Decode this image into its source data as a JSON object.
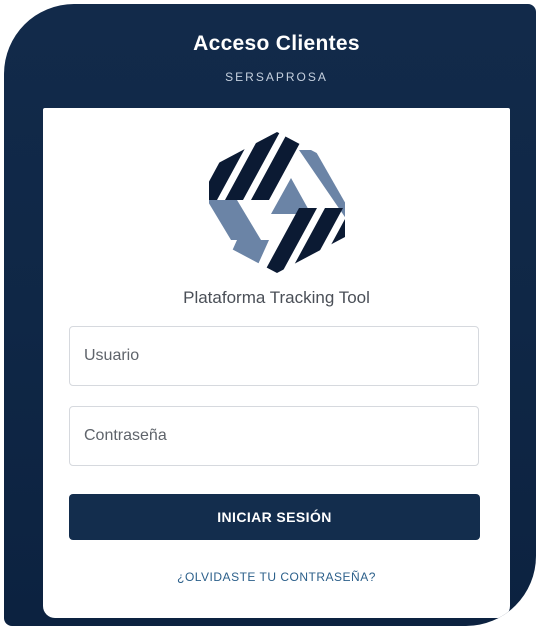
{
  "header": {
    "title": "Acceso Clientes",
    "subtitle": "SERSAPROSA"
  },
  "card": {
    "logo_icon": "hexagon-stripes-logo-icon",
    "platform_name": "Plataforma Tracking  Tool"
  },
  "form": {
    "username_placeholder": "Usuario",
    "username_value": "",
    "password_placeholder": "Contraseña",
    "password_value": "",
    "submit_label": "INICIAR SESIÓN",
    "forgot_label": "¿OLVIDASTE TU CONTRASEÑA?"
  },
  "colors": {
    "frame_bg": "#0f2746",
    "button_bg": "#132d4d",
    "logo_dark": "#0b1a33",
    "logo_light": "#6b84a6",
    "link": "#2b5f8a"
  }
}
